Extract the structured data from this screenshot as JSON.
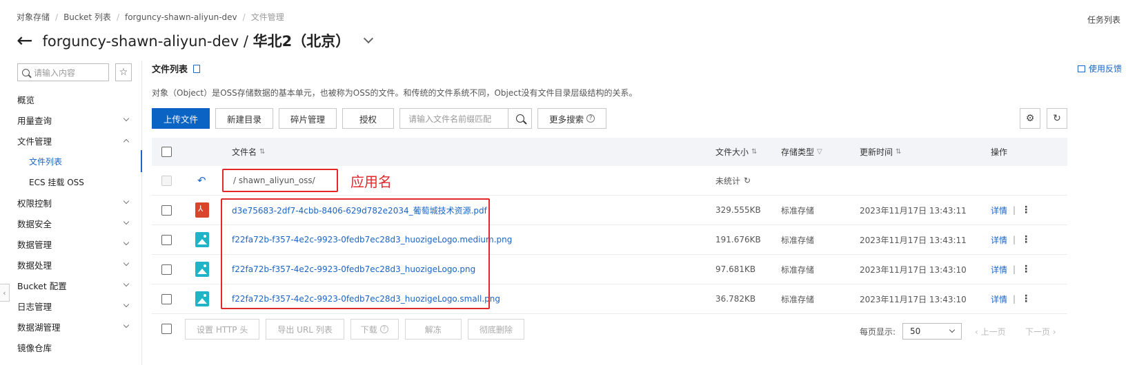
{
  "breadcrumb": [
    "对象存储",
    "Bucket 列表",
    "forguncy-shawn-aliyun-dev",
    "文件管理"
  ],
  "task_list": "任务列表",
  "title": {
    "bucket": "forguncy-shawn-aliyun-dev",
    "sep": " / ",
    "region": "华北2（北京）"
  },
  "sidebar": {
    "search_placeholder": "请输入内容",
    "items": [
      {
        "label": "概览"
      },
      {
        "label": "用量查询"
      },
      {
        "label": "文件管理"
      },
      {
        "label": "文件列表"
      },
      {
        "label": "ECS 挂载 OSS"
      },
      {
        "label": "权限控制"
      },
      {
        "label": "数据安全"
      },
      {
        "label": "数据管理"
      },
      {
        "label": "数据处理"
      },
      {
        "label": "Bucket 配置"
      },
      {
        "label": "日志管理"
      },
      {
        "label": "数据湖管理"
      },
      {
        "label": "镜像仓库"
      }
    ]
  },
  "main": {
    "title": "文件列表",
    "feedback": "使用反馈",
    "description": "对象（Object）是OSS存储数据的基本单元，也被称为OSS的文件。和传统的文件系统不同，Object没有文件目录层级结构的关系。"
  },
  "toolbar": {
    "upload": "上传文件",
    "new_dir": "新建目录",
    "fragments": "碎片管理",
    "authorize": "授权",
    "search_placeholder": "请输入文件名前缀匹配",
    "more_search": "更多搜索"
  },
  "table": {
    "headers": {
      "name": "文件名",
      "size": "文件大小",
      "storage": "存储类型",
      "updated": "更新时间",
      "actions": "操作"
    },
    "folder_row": {
      "path": "/ shawn_aliyun_oss/",
      "size": "未统计"
    },
    "rows": [
      {
        "name": "d3e75683-2df7-4cbb-8406-629d782e2034_葡萄城技术资源.pdf",
        "icon": "pdf-icon",
        "size": "329.555KB",
        "storage": "标准存储",
        "updated": "2023年11月17日 13:43:11",
        "detail": "详情"
      },
      {
        "name": "f22fa72b-f357-4e2c-9923-0fedb7ec28d3_huozigeLogo.medium.png",
        "icon": "image-icon",
        "size": "191.676KB",
        "storage": "标准存储",
        "updated": "2023年11月17日 13:43:11",
        "detail": "详情"
      },
      {
        "name": "f22fa72b-f357-4e2c-9923-0fedb7ec28d3_huozigeLogo.png",
        "icon": "image-icon",
        "size": "97.681KB",
        "storage": "标准存储",
        "updated": "2023年11月17日 13:43:10",
        "detail": "详情"
      },
      {
        "name": "f22fa72b-f357-4e2c-9923-0fedb7ec28d3_huozigeLogo.small.png",
        "icon": "image-icon",
        "size": "36.782KB",
        "storage": "标准存储",
        "updated": "2023年11月17日 13:43:10",
        "detail": "详情"
      }
    ]
  },
  "annotation": "应用名",
  "bottom": {
    "set_http": "设置 HTTP 头",
    "export_url": "导出 URL 列表",
    "download": "下载",
    "unfreeze": "解冻",
    "delete": "彻底删除",
    "per_page_label": "每页显示:",
    "per_page_value": "50",
    "prev": "上一页",
    "next": "下一页"
  },
  "colors": {
    "accent": "#0b63c4",
    "annotation_red": "#e0282b",
    "link": "#1a64c8"
  }
}
